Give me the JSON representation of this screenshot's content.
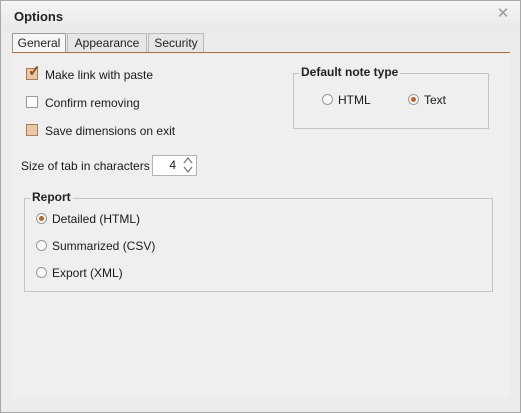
{
  "window": {
    "title": "Options",
    "close_icon": "close-icon"
  },
  "tabs": [
    {
      "label": "General",
      "active": true
    },
    {
      "label": "Appearance",
      "active": false
    },
    {
      "label": "Security",
      "active": false
    }
  ],
  "options": {
    "make_link": {
      "label": "Make link with paste",
      "checked": true
    },
    "confirm_removing": {
      "label": "Confirm removing",
      "checked": false
    },
    "save_dimensions": {
      "label": "Save dimensions on exit",
      "checked": false
    }
  },
  "note_type": {
    "title": "Default note type",
    "html_label": "HTML",
    "text_label": "Text",
    "selected": "Text"
  },
  "tab_size": {
    "label": "Size of tab in characters",
    "value": "4"
  },
  "report": {
    "title": "Report",
    "detailed_label": "Detailed (HTML)",
    "summarized_label": "Summarized (CSV)",
    "export_label": "Export (XML)",
    "selected": "Detailed (HTML)"
  },
  "colors": {
    "accent": "#c0622a",
    "tab_underline": "#b76a3a",
    "window_bg": "#ececec"
  }
}
